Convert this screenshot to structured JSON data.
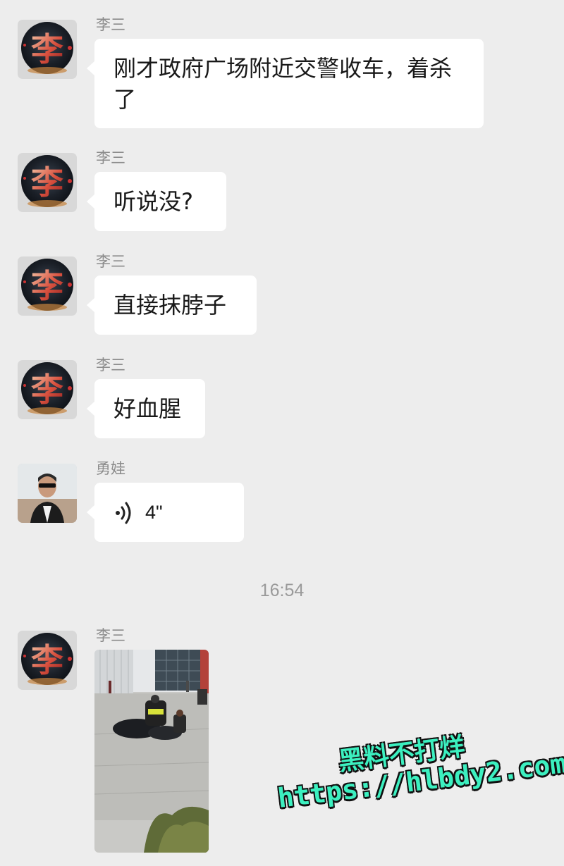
{
  "messages": [
    {
      "sender": "李三",
      "text": "刚才政府广场附近交警收车，着杀了"
    },
    {
      "sender": "李三",
      "text": "听说没?"
    },
    {
      "sender": "李三",
      "text": "直接抹脖子"
    },
    {
      "sender": "李三",
      "text": "好血腥"
    },
    {
      "sender": "勇娃",
      "voice_duration": "4\""
    },
    {
      "sender": "李三",
      "type": "image"
    }
  ],
  "timestamp": "16:54",
  "avatar_glyph": "李",
  "watermark": {
    "line1": "黑料不打烊",
    "line2": "https://hlbdy2.com"
  },
  "colors": {
    "background": "#ededed",
    "bubble": "#ffffff",
    "watermark": "#3cf0c0"
  }
}
